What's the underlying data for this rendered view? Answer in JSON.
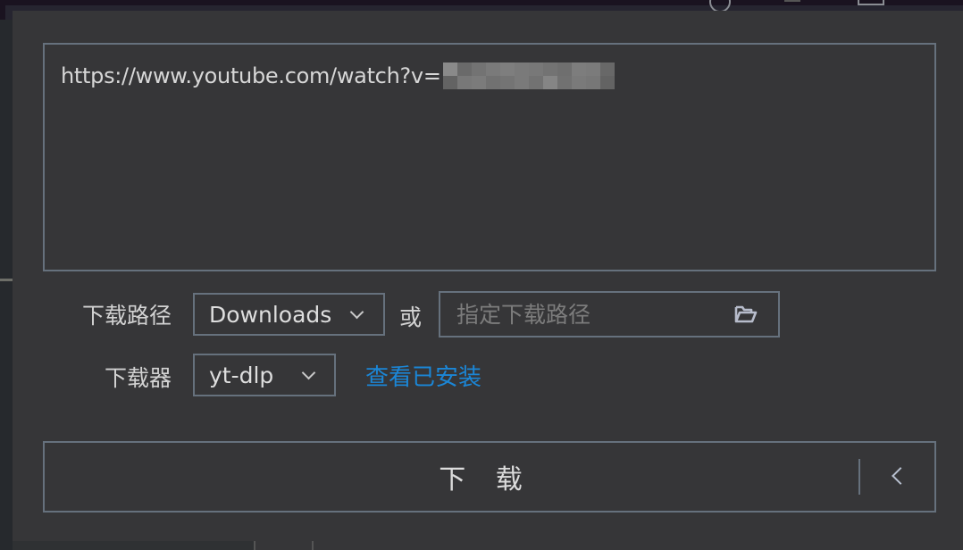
{
  "url_input": {
    "value_prefix": "https://www.youtube.com/watch?v=",
    "redacted": true,
    "redacted_pixels": [
      "#8a8a8a",
      "#6a6a6a",
      "#737373",
      "#7a7a7a",
      "#7e7e7e",
      "#7a7a7a",
      "#787878",
      "#737373",
      "#6f6f6f",
      "#7d7d7d",
      "#7b7b7b",
      "#686868",
      "#636363",
      "#787878",
      "#7b7b7b",
      "#717171",
      "#747474",
      "#7a7a7a",
      "#727272",
      "#858585",
      "#717171",
      "#7a7a7a",
      "#777777",
      "#636363"
    ]
  },
  "download_path": {
    "label": "下载路径",
    "selected": "Downloads",
    "or_label": "或",
    "custom_path_placeholder": "指定下载路径",
    "custom_path_value": "",
    "browse_icon": "folder-open-icon"
  },
  "downloader": {
    "label": "下载器",
    "selected": "yt-dlp",
    "view_installed_link": "查看已安装"
  },
  "actions": {
    "download_label": "下 载",
    "expand_icon": "chevron-left-icon"
  },
  "colors": {
    "panel_bg": "#363638",
    "border": "#66717d",
    "link": "#1b86d6",
    "text": "#d2d2d2",
    "placeholder": "#7c7c7c"
  }
}
